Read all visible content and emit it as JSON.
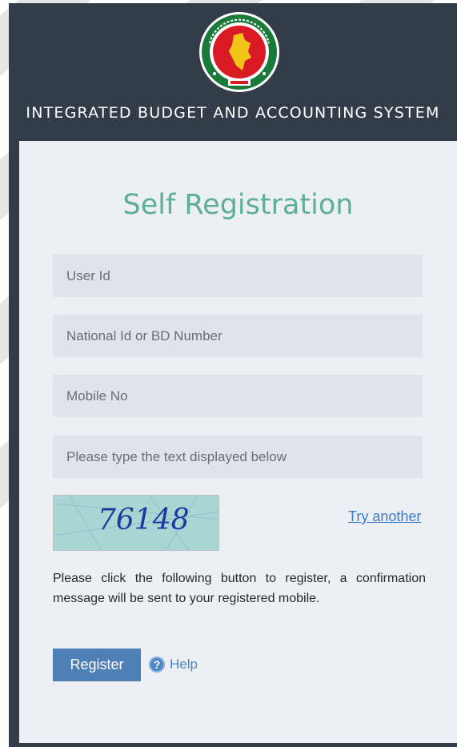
{
  "header": {
    "system_title": "INTEGRATED BUDGET AND ACCOUNTING SYSTEM"
  },
  "form": {
    "title": "Self Registration",
    "user_id_placeholder": "User Id",
    "national_id_placeholder": "National Id or BD Number",
    "mobile_placeholder": "Mobile No",
    "captcha_input_placeholder": "Please type the text displayed below",
    "captcha_text": "76148",
    "try_another_label": "Try another",
    "info_text": "Please click the following button to register, a confirmation message will be sent to your registered mobile.",
    "register_label": "Register",
    "help_label": "Help"
  },
  "icons": {
    "emblem": "bangladesh-government-emblem-icon",
    "help": "question-circle-icon"
  },
  "colors": {
    "header_bg": "#333d4a",
    "title_teal": "#5dae9b",
    "register_bg": "#4e7fb5",
    "link_blue": "#3d7cc9"
  }
}
